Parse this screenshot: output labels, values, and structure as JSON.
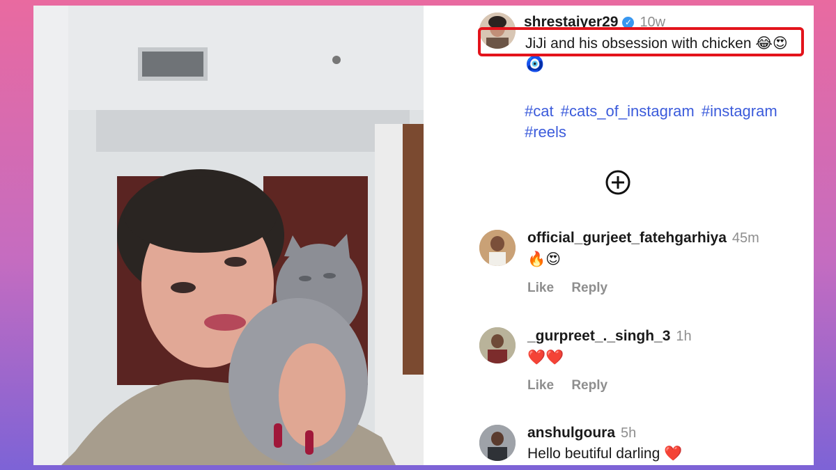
{
  "post": {
    "username": "shrestaiyer29",
    "time": "10w",
    "caption": "JiJi and his obsession with chicken",
    "caption_emojis": "😂😍",
    "extra_emoji": "🧿",
    "hashtags": [
      "#cat",
      "#cats_of_instagram",
      "#instagram",
      "#reels"
    ]
  },
  "comments": [
    {
      "username": "official_gurjeet_fatehgarhiya",
      "time": "45m",
      "text": "🔥😍",
      "like_label": "Like",
      "reply_label": "Reply"
    },
    {
      "username": "_gurpreet_._singh_3",
      "time": "1h",
      "text": "❤️❤️",
      "like_label": "Like",
      "reply_label": "Reply"
    },
    {
      "username": "anshulgoura",
      "time": "5h",
      "text": "Hello beutiful darling ❤️"
    }
  ],
  "colors": {
    "highlight": "#e3131b",
    "hashtag": "#3b5bdb",
    "verified": "#3897f0"
  },
  "icons": {
    "add": "plus-circle-icon",
    "verified": "verified-badge-icon"
  }
}
